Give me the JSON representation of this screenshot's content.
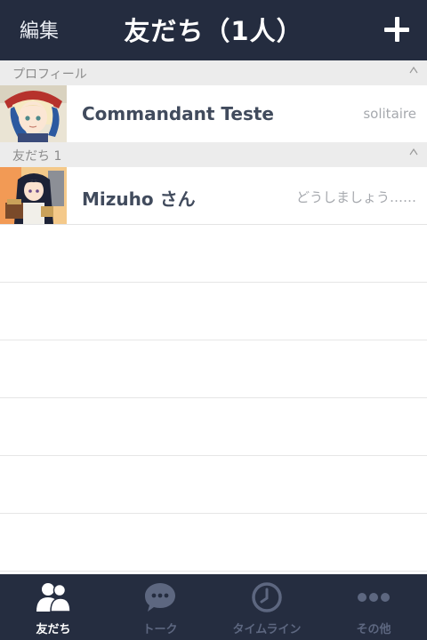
{
  "header": {
    "edit_label": "編集",
    "title": "友だち（1人）",
    "add_icon": "plus-icon"
  },
  "sections": [
    {
      "label": "プロフィール",
      "icon": "collapse-caret-icon"
    },
    {
      "label": "友だち 1",
      "icon": "collapse-caret-icon"
    }
  ],
  "profile": {
    "name": "Commandant Teste",
    "status": "solitaire",
    "avatar": "profile-avatar"
  },
  "friends": [
    {
      "name": "Mizuho さん",
      "status": "どうしましょう……",
      "avatar": "friend-avatar"
    }
  ],
  "tabs": [
    {
      "label": "友だち",
      "icon": "friends-icon",
      "active": true
    },
    {
      "label": "トーク",
      "icon": "chat-bubble-icon",
      "active": false
    },
    {
      "label": "タイムライン",
      "icon": "clock-icon",
      "active": false
    },
    {
      "label": "その他",
      "icon": "more-dots-icon",
      "active": false
    }
  ],
  "colors": {
    "header_bg": "#242c3f",
    "tabbar_bg": "#252d40",
    "section_bg": "#ececec",
    "name_text": "#414b5d",
    "inactive_tab": "#5d6780"
  }
}
